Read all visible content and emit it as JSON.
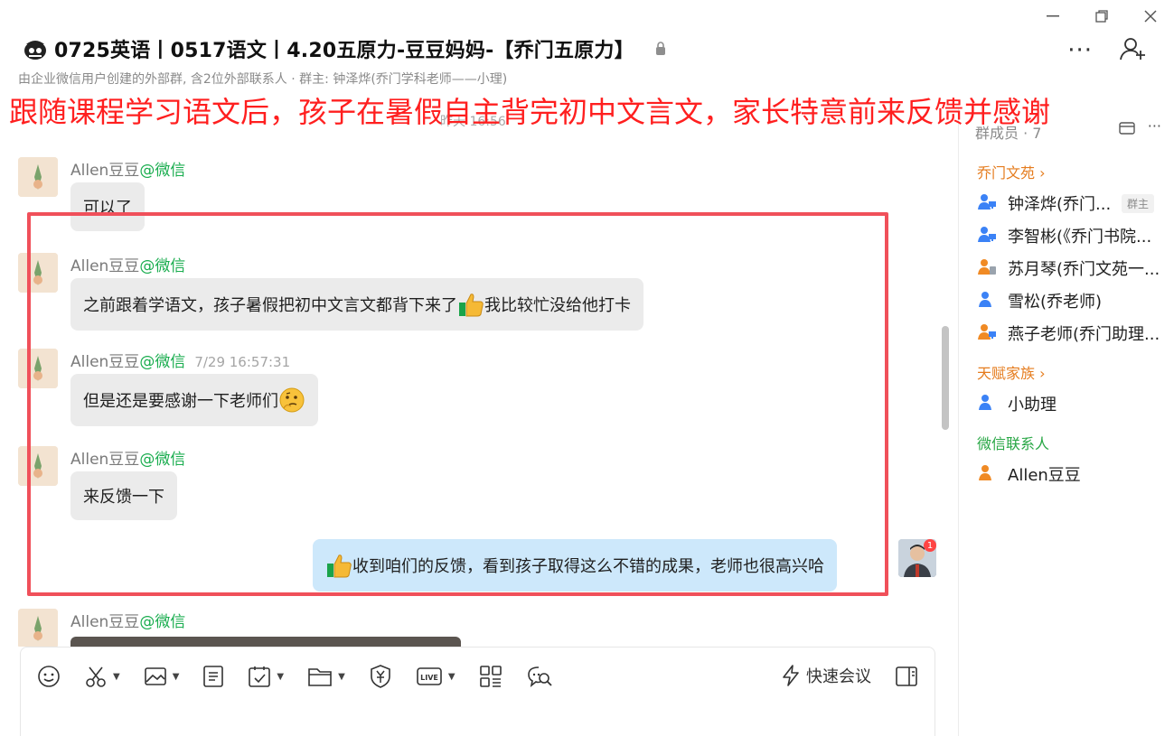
{
  "window": {
    "minimize": "—",
    "restore": "❐",
    "close": "✕"
  },
  "header": {
    "title": "0725英语丨0517语文丨4.20五原力-豆豆妈妈-【乔门五原力】",
    "subtitle": "由企业微信用户创建的外部群, 含2位外部联系人 · 群主: 钟泽烨(乔门学科老师——小理)",
    "more": "···"
  },
  "overlay_banner": "跟随课程学习语文后，孩子在暑假自主背完初中文言文，家长特意前来反馈并感谢",
  "chat": {
    "time_divider": "昨天 16:56",
    "messages": [
      {
        "sender": "Allen豆豆",
        "source": "@微信",
        "time": "",
        "text": "可以了"
      },
      {
        "sender": "Allen豆豆",
        "source": "@微信",
        "time": "",
        "text_before": "之前跟着学语文，孩子暑假把初中文言文都背下来了",
        "emoji": "thumbs-up",
        "text_after": "我比较忙没给他打卡"
      },
      {
        "sender": "Allen豆豆",
        "source": "@微信",
        "time": "7/29 16:57:31",
        "text": "但是还是要感谢一下老师们",
        "emoji": "thinking-face"
      },
      {
        "sender": "Allen豆豆",
        "source": "@微信",
        "time": "",
        "text": "来反馈一下"
      },
      {
        "sender": "Allen豆豆",
        "source": "@微信",
        "time": "",
        "text": ""
      }
    ],
    "self_message": {
      "emoji": "thumbs-up",
      "text": "收到咱们的反馈，看到孩子取得这么不错的成果，老师也很高兴哈",
      "badge": "1"
    }
  },
  "composer": {
    "tools": [
      "emoji-icon",
      "scissors-icon",
      "image-icon",
      "document-icon",
      "calendar-check-icon",
      "folder-icon",
      "payment-icon",
      "live-icon",
      "apps-icon",
      "chat-search-icon"
    ],
    "quick_meeting": "快速会议"
  },
  "members": {
    "header": "群成员 · 7",
    "sections": [
      {
        "name": "乔门文苑 ›",
        "color": "#e57c1e",
        "items": [
          {
            "name": "钟泽烨(乔门...",
            "tag": "群主",
            "icon": "user-desktop-icon"
          },
          {
            "name": "李智彬(《乔门书院...",
            "icon": "user-desktop-icon"
          },
          {
            "name": "苏月琴(乔门文苑一...",
            "icon": "user-mobile-icon"
          },
          {
            "name": "雪松(乔老师)",
            "icon": "user-icon"
          },
          {
            "name": "燕子老师(乔门助理...",
            "icon": "user-desktop-icon"
          }
        ]
      },
      {
        "name": "天赋家族 ›",
        "color": "#e57c1e",
        "items": [
          {
            "name": "小助理",
            "icon": "user-icon"
          }
        ]
      },
      {
        "name": "微信联系人",
        "color": "#28a745",
        "items": [
          {
            "name": "Allen豆豆",
            "icon": "wechat-user-icon"
          }
        ]
      }
    ]
  },
  "colors": {
    "accent_red": "#f0505a",
    "wechat_green": "#1aad4f",
    "section_orange": "#e57c1e",
    "self_bubble": "#cde8fb"
  }
}
